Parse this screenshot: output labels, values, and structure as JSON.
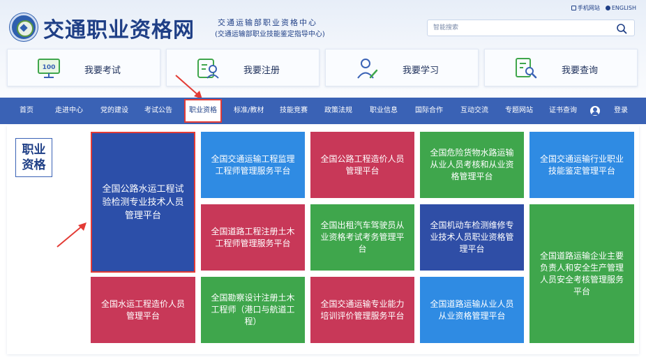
{
  "header": {
    "site_title": "交通职业资格网",
    "org_name": "交通运输部职业资格中心",
    "org_sub": "(交通运输部职业技能鉴定指导中心)",
    "top_links": [
      "手机网站",
      "ENGLISH"
    ],
    "search": {
      "placeholder": "智能搜索"
    }
  },
  "quick_buttons": [
    {
      "label": "我要考试",
      "icon": "monitor-100-icon"
    },
    {
      "label": "我要注册",
      "icon": "register-card-icon"
    },
    {
      "label": "我要学习",
      "icon": "study-person-icon"
    },
    {
      "label": "我要查询",
      "icon": "search-document-icon"
    }
  ],
  "nav": {
    "items": [
      "首页",
      "走进中心",
      "党的建设",
      "考试公告",
      "职业资格",
      "标准/教材",
      "技能竞赛",
      "政策法规",
      "职业信息",
      "国际合作",
      "互动交流",
      "专题网站",
      "证书查询",
      "登录"
    ],
    "active": "职业资格"
  },
  "section": {
    "label_line1": "职业",
    "label_line2": "资格"
  },
  "tiles": [
    "全国公路水运工程试验检测专业技术人员管理平台",
    "全国交通运输工程监理工程师管理服务平台",
    "全国公路工程造价人员管理平台",
    "全国危险货物水路运输从业人员考核和从业资格管理平台",
    "全国交通运输行业职业技能鉴定管理平台",
    "全国道路工程注册土木工程师管理服务平台",
    "全国出租汽车驾驶员从业资格考试考务管理平台",
    "全国机动车检测维修专业技术人员职业资格管理平台",
    "全国道路运输企业主要负责人和安全生产管理人员安全考核管理服务平台",
    "全国水运工程造价人员管理平台",
    "全国勘察设计注册土木工程师（港口与航道工程）",
    "全国交通运输专业能力培训评价管理服务平台",
    "全国道路运输从业人员从业资格管理平台"
  ],
  "colors": {
    "brand_blue": "#3a62b5",
    "highlight_red": "#e33b35",
    "tile_navy": "#2c4fa9",
    "tile_blue": "#2f8be3",
    "tile_red": "#c83858",
    "tile_green": "#3fa64c"
  }
}
